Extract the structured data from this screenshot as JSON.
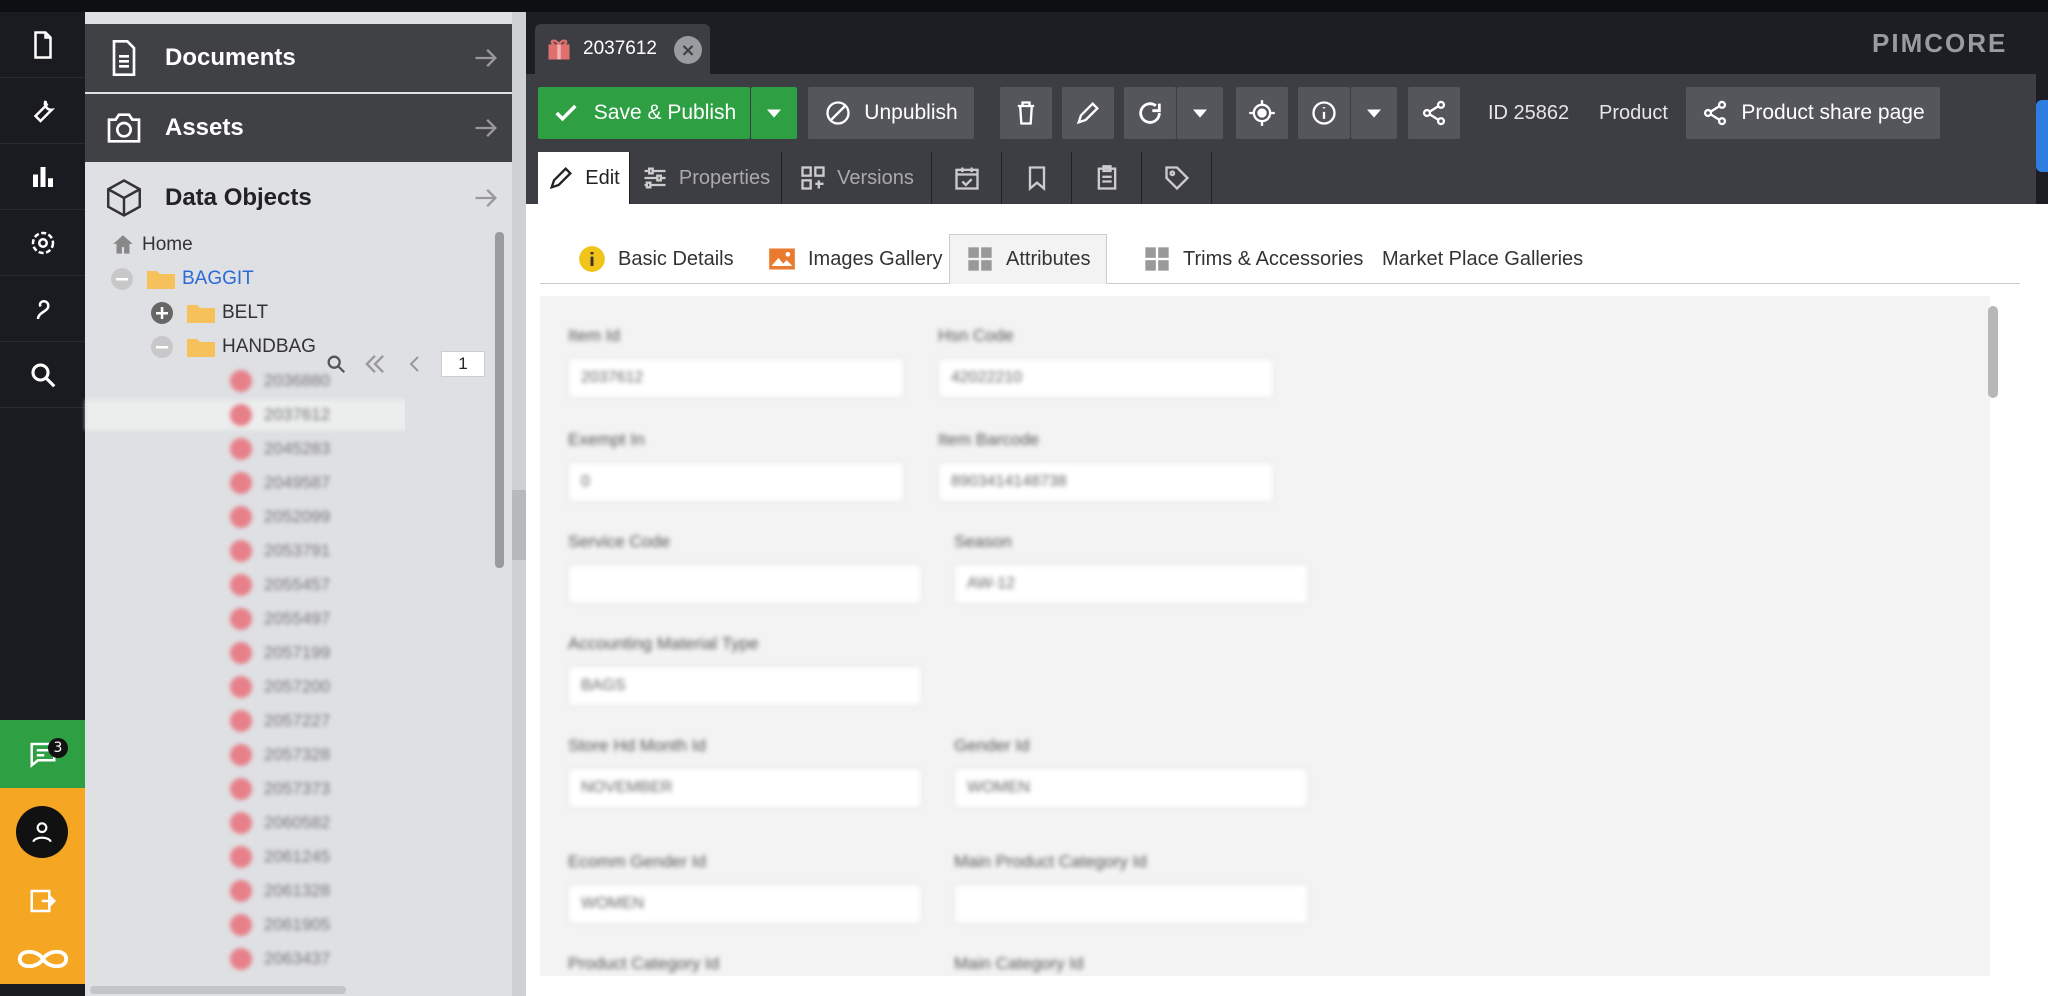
{
  "nav": {
    "documents": "Documents",
    "assets": "Assets",
    "data_objects": "Data Objects"
  },
  "rail": {
    "chat_count": "3",
    "icons": [
      "document-icon",
      "tools-icon",
      "chart-icon",
      "settings-icon",
      "marketing-icon",
      "search-icon",
      "chat-icon",
      "user-icon",
      "logout-icon",
      "pimcore-logo-icon"
    ]
  },
  "tree": {
    "home": "Home",
    "baggit": "BAGGIT",
    "belt": "BELT",
    "handbag": "HANDBAG",
    "page": "1",
    "items": [
      "2036880",
      "2037612",
      "2045283",
      "2049587",
      "2052099",
      "2053791",
      "2055457",
      "2055497",
      "2057199",
      "2057200",
      "2057227",
      "2057328",
      "2057373",
      "2060582",
      "2061245",
      "2061328",
      "2061905",
      "2063437"
    ]
  },
  "tab": {
    "title": "2037612"
  },
  "brand": {
    "logo": "PIMCORE"
  },
  "toolbar": {
    "save_publish": "Save & Publish",
    "unpublish": "Unpublish",
    "id": "ID 25862",
    "class": "Product",
    "share_page": "Product share page"
  },
  "view_tabs": {
    "edit": "Edit",
    "properties": "Properties",
    "versions": "Versions"
  },
  "sub_tabs": {
    "basic": "Basic Details",
    "images": "Images Gallery",
    "attributes": "Attributes",
    "trims": "Trims & Accessories",
    "market": "Market Place Galleries"
  },
  "form": {
    "item_id_label": "Item Id",
    "item_id_value": "2037612",
    "hsn_label": "Hsn Code",
    "hsn_value": "42022210",
    "exempt_label": "Exempt In",
    "exempt_value": "0",
    "barcode_label": "Item Barcode",
    "barcode_value": "8903414148738",
    "service_label": "Service Code",
    "service_value": "",
    "season_label": "Season",
    "season_value": "AW-12",
    "accounting_label": "Accounting Material Type",
    "accounting_value": "BAGS",
    "store_label": "Store Hd Month Id",
    "store_value": "NOVEMBER",
    "gender_label": "Gender Id",
    "gender_value": "WOMEN",
    "ecomm_label": "Ecomm Gender Id",
    "ecomm_value": "WOMEN",
    "main_cat_label": "Main Product Category Id",
    "main_cat_value": "",
    "prod_cat_label": "Product Category Id",
    "main_category_label": "Main Category Id"
  },
  "colors": {
    "save_green": "#2ea043",
    "accent_orange": "#f5a623",
    "nav_dark": "#404145",
    "rail_dark": "#1a1b20"
  }
}
